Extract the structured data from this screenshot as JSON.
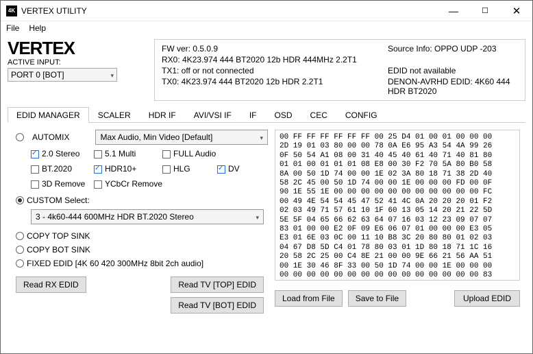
{
  "window": {
    "title": "VERTEX UTILITY",
    "icon_label": "4K"
  },
  "menu": {
    "file": "File",
    "help": "Help"
  },
  "brand": {
    "logo": "VERTEX",
    "active_label": "ACTIVE INPUT:",
    "port_sel": "PORT 0 [BOT]"
  },
  "info": {
    "fw": "FW ver: 0.5.0.9",
    "src": "Source Info: OPPO UDP -203",
    "rx0": "RX0: 4K23.974 444 BT2020 12b HDR 444MHz 2.2T1",
    "blank1": "",
    "tx1": "TX1: off or not connected",
    "edid_na": "EDID not available",
    "tx0": "TX0: 4K23.974 444 BT2020 12b HDR 2.2T1",
    "denon": "DENON-AVRHD EDID: 4K60 444 HDR BT2020"
  },
  "tabs": [
    "EDID MANAGER",
    "SCALER",
    "HDR IF",
    "AVI/VSI IF",
    "IF",
    "OSD",
    "CEC",
    "CONFIG"
  ],
  "edid": {
    "automix": "AUTOMIX",
    "max_combo": "Max Audio, Min Video [Default]",
    "chk": {
      "stereo": "2.0 Stereo",
      "multi": "5.1 Multi",
      "full": "FULL Audio",
      "bt2020": "BT.2020",
      "hdr10": "HDR10+",
      "hlg": "HLG",
      "dv": "DV",
      "remove3d": "3D Remove",
      "ycbcr": "YCbCr Remove"
    },
    "custom": "CUSTOM Select:",
    "custom_combo": "3 - 4k60-444 600MHz HDR BT.2020 Stereo",
    "copytop": "COPY TOP SINK",
    "copybot": "COPY BOT SINK",
    "fixed": "FIXED EDID [4K 60 420 300MHz 8bit 2ch audio]",
    "btn_readrx": "Read RX  EDID",
    "btn_readtop": "Read TV [TOP] EDID",
    "btn_readbot": "Read TV [BOT] EDID",
    "btn_load": "Load from File",
    "btn_save": "Save to File",
    "btn_upload": "Upload EDID"
  },
  "hex": "00 FF FF FF FF FF FF 00 25 D4 01 00 01 00 00 00\n2D 19 01 03 80 00 00 78 0A E6 95 A3 54 4A 99 26\n0F 50 54 A1 08 00 31 40 45 40 61 40 71 40 81 80\n01 01 00 01 01 01 08 E8 00 30 F2 70 5A 80 B0 58\n8A 00 50 1D 74 00 00 1E 02 3A 80 18 71 38 2D 40\n58 2C 45 00 50 1D 74 00 00 1E 00 00 00 FD 00 0F\n90 1E 55 1E 00 00 00 00 00 00 00 00 00 00 00 FC\n00 49 4E 54 54 45 47 52 41 4C 0A 20 20 20 01 F2\n02 03 49 71 57 61 10 1F 60 13 05 14 20 21 22 5D\n5E 5F 04 65 66 62 63 64 07 16 03 12 23 09 07 07\n83 01 00 00 E2 0F 09 E6 06 07 01 00 00 00 E3 05\nE3 01 6E 03 0C 00 11 10 B8 3C 20 80 80 01 02 03\n04 67 D8 5D C4 01 78 80 03 01 1D 80 18 71 1C 16\n20 58 2C 25 00 C4 8E 21 00 00 9E 66 21 56 AA 51\n00 1E 30 46 8F 33 00 50 1D 74 00 00 1E 00 00 00\n00 00 00 00 00 00 00 00 00 00 00 00 00 00 00 83"
}
